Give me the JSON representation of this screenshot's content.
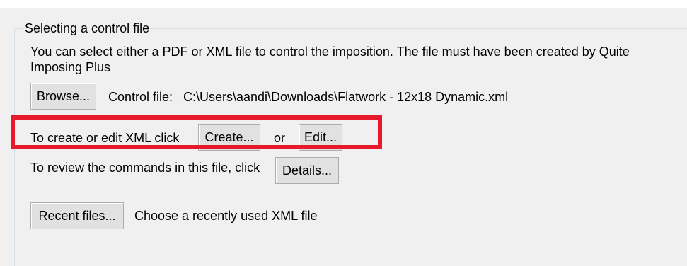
{
  "groupbox": {
    "title": "Selecting a control file",
    "description": "You can select either a PDF or XML file to control the imposition. The file must have been created by Quite Imposing Plus"
  },
  "browse_row": {
    "button_label": "Browse...",
    "control_file_label": "Control file:",
    "control_file_path": "C:\\Users\\aandi\\Downloads\\Flatwork - 12x18 Dynamic.xml"
  },
  "xml_row": {
    "prompt": "To create or edit XML click",
    "create_label": "Create...",
    "or_text": "or",
    "edit_label": "Edit..."
  },
  "review_row": {
    "prompt": "To review the commands in this file, click",
    "details_label": "Details..."
  },
  "recent_row": {
    "button_label": "Recent files...",
    "hint": "Choose a recently used XML file"
  },
  "colors": {
    "highlight": "#e8192c",
    "background": "#f0f0f0",
    "button_face": "#e1e1e1"
  }
}
